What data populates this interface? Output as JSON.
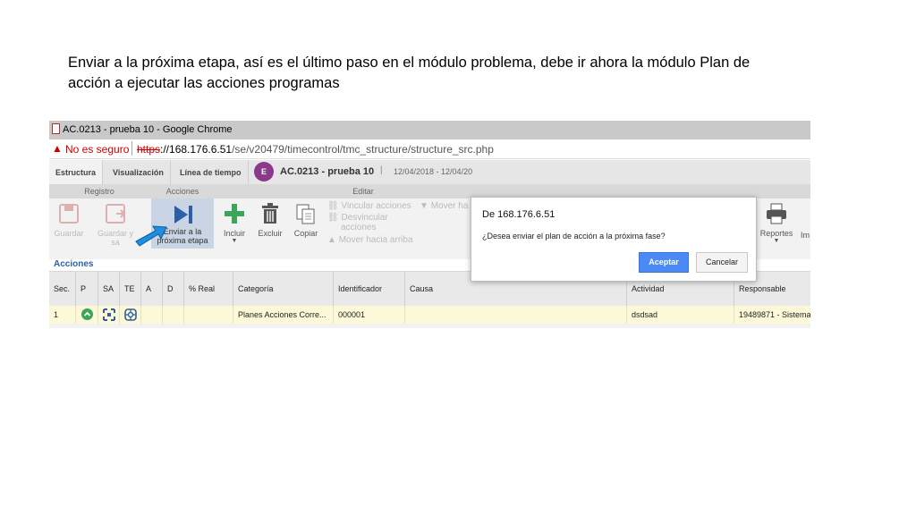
{
  "caption": "Enviar a la próxima etapa, así es el último paso en el módulo problema, debe ir ahora la módulo Plan de acción a ejecutar las acciones programas",
  "window": {
    "title": "AC.0213 - prueba 10 - Google Chrome"
  },
  "address_bar": {
    "security": "No es seguro",
    "scheme": "https",
    "host": "://168.176.6.51",
    "path": "/se/v20479/timecontrol/tmc_structure/structure_src.php"
  },
  "tabs": [
    "Estructura",
    "Visualización",
    "Línea de tiempo"
  ],
  "record": {
    "badge": "E",
    "title": "AC.0213 - prueba 10",
    "separator": "|",
    "dates": "12/04/2018 - 12/04/20"
  },
  "groups": [
    "Registro",
    "Acciones",
    "Editar"
  ],
  "tools": {
    "guardar": "Guardar",
    "guardar_y": "Guardar y sa",
    "enviar_1": "Enviar a la",
    "enviar_2": "próxima etapa",
    "incluir": "Incluir",
    "excluir": "Excluir",
    "copiar": "Copiar",
    "vincular": "Vincular acciones",
    "desvincular_1": "Desvincular",
    "desvincular_2": "acciones",
    "mover_arriba": "Mover hacia arriba",
    "mover_ha": "Mover ha",
    "reportes": "Reportes",
    "im": "Im"
  },
  "section": "Acciones",
  "table": {
    "headers": [
      "Sec.",
      "P",
      "SA",
      "TE",
      "A",
      "D",
      "% Real",
      "Categoría",
      "Identificador",
      "Causa",
      "Actividad",
      "Responsable"
    ],
    "rows": [
      {
        "sec": "1",
        "categoria": "Planes Acciones Corre...",
        "identificador": "000001",
        "causa": "",
        "actividad": "dsdsad",
        "responsable": "19489871 - Sistema"
      }
    ]
  },
  "dialog": {
    "title": "De 168.176.6.51",
    "message": "¿Desea enviar el plan de acción a la próxima fase?",
    "ok": "Aceptar",
    "cancel": "Cancelar"
  },
  "colors": {
    "accent": "#4a8af4",
    "badge": "#8b3a8b",
    "row_highlight": "#fdf9d8",
    "arrow": "#1e8fe0",
    "play": "#2d5ea8",
    "green": "#3aa65a"
  }
}
